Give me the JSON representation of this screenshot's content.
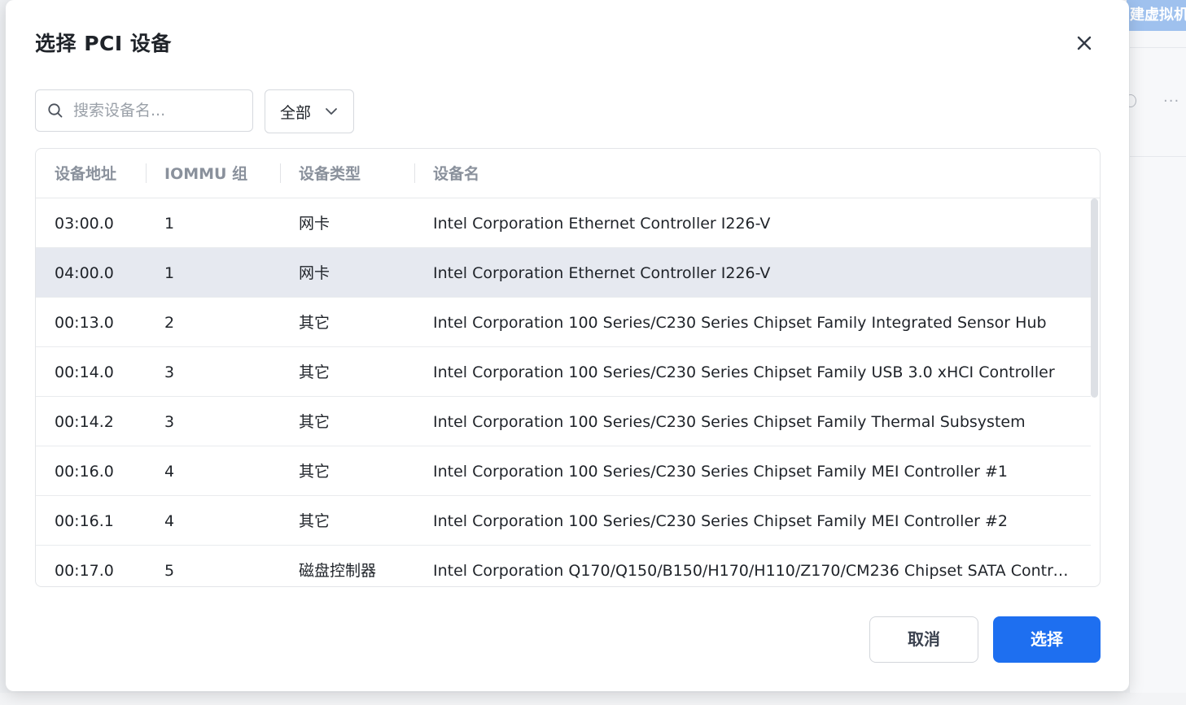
{
  "background": {
    "create_button_label": "建虚拟机",
    "more_label": "···"
  },
  "dialog": {
    "title": "选择 PCI 设备",
    "search_placeholder": "搜索设备名...",
    "filter_value": "全部",
    "columns": [
      "设备地址",
      "IOMMU 组",
      "设备类型",
      "设备名"
    ],
    "rows": [
      {
        "address": "03:00.0",
        "iommu": "1",
        "type": "网卡",
        "name": "Intel Corporation Ethernet Controller I226-V"
      },
      {
        "address": "04:00.0",
        "iommu": "1",
        "type": "网卡",
        "name": "Intel Corporation Ethernet Controller I226-V"
      },
      {
        "address": "00:13.0",
        "iommu": "2",
        "type": "其它",
        "name": "Intel Corporation 100 Series/C230 Series Chipset Family Integrated Sensor Hub"
      },
      {
        "address": "00:14.0",
        "iommu": "3",
        "type": "其它",
        "name": "Intel Corporation 100 Series/C230 Series Chipset Family USB 3.0 xHCI Controller"
      },
      {
        "address": "00:14.2",
        "iommu": "3",
        "type": "其它",
        "name": "Intel Corporation 100 Series/C230 Series Chipset Family Thermal Subsystem"
      },
      {
        "address": "00:16.0",
        "iommu": "4",
        "type": "其它",
        "name": "Intel Corporation 100 Series/C230 Series Chipset Family MEI Controller #1"
      },
      {
        "address": "00:16.1",
        "iommu": "4",
        "type": "其它",
        "name": "Intel Corporation 100 Series/C230 Series Chipset Family MEI Controller #2"
      },
      {
        "address": "00:17.0",
        "iommu": "5",
        "type": "磁盘控制器",
        "name": "Intel Corporation Q170/Q150/B150/H170/H110/Z170/CM236 Chipset SATA Contro..."
      }
    ],
    "selected_row_index": 1,
    "cancel_label": "取消",
    "confirm_label": "选择",
    "colors": {
      "primary": "#1e6ff0",
      "selected_row": "#e6e9f0"
    }
  }
}
